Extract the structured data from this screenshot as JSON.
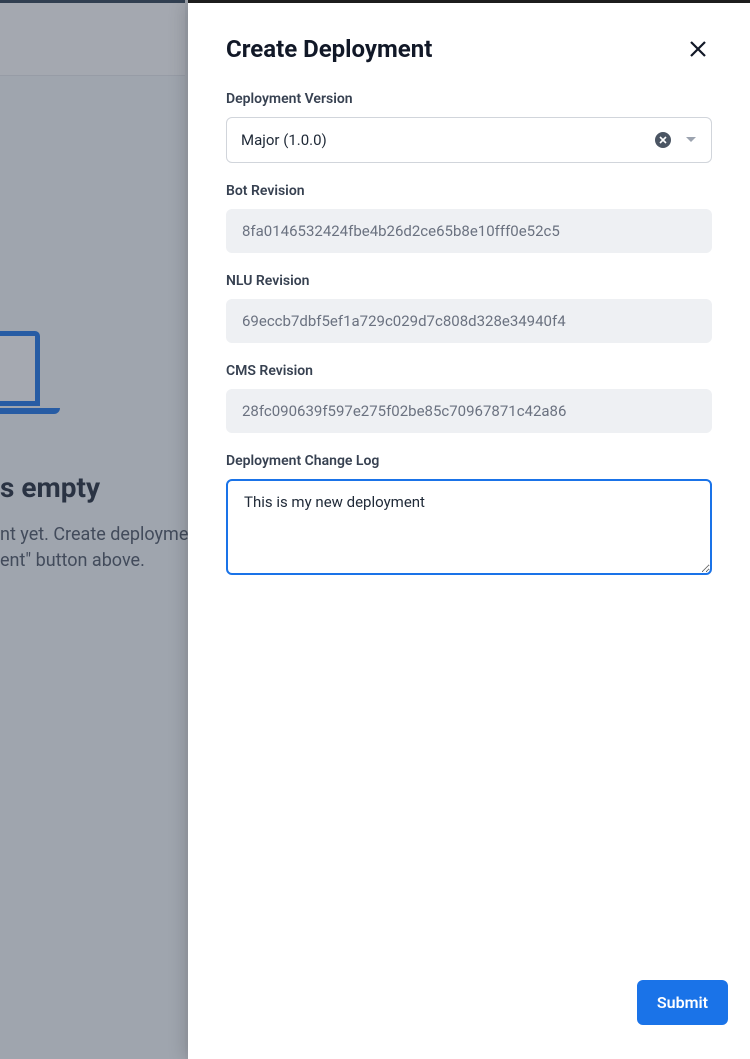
{
  "background": {
    "empty_heading_fragment": "s empty",
    "empty_line1_fragment": "nt yet. Create deployme",
    "empty_line2_fragment": "ent\" button above."
  },
  "panel": {
    "title": "Create Deployment",
    "fields": {
      "version": {
        "label": "Deployment Version",
        "value": "Major (1.0.0)"
      },
      "bot_revision": {
        "label": "Bot Revision",
        "value": "8fa0146532424fbe4b26d2ce65b8e10fff0e52c5"
      },
      "nlu_revision": {
        "label": "NLU Revision",
        "value": "69eccb7dbf5ef1a729c029d7c808d328e34940f4"
      },
      "cms_revision": {
        "label": "CMS Revision",
        "value": "28fc090639f597e275f02be85c70967871c42a86"
      },
      "change_log": {
        "label": "Deployment Change Log",
        "value": "This is my new deployment"
      }
    },
    "submit_label": "Submit"
  }
}
